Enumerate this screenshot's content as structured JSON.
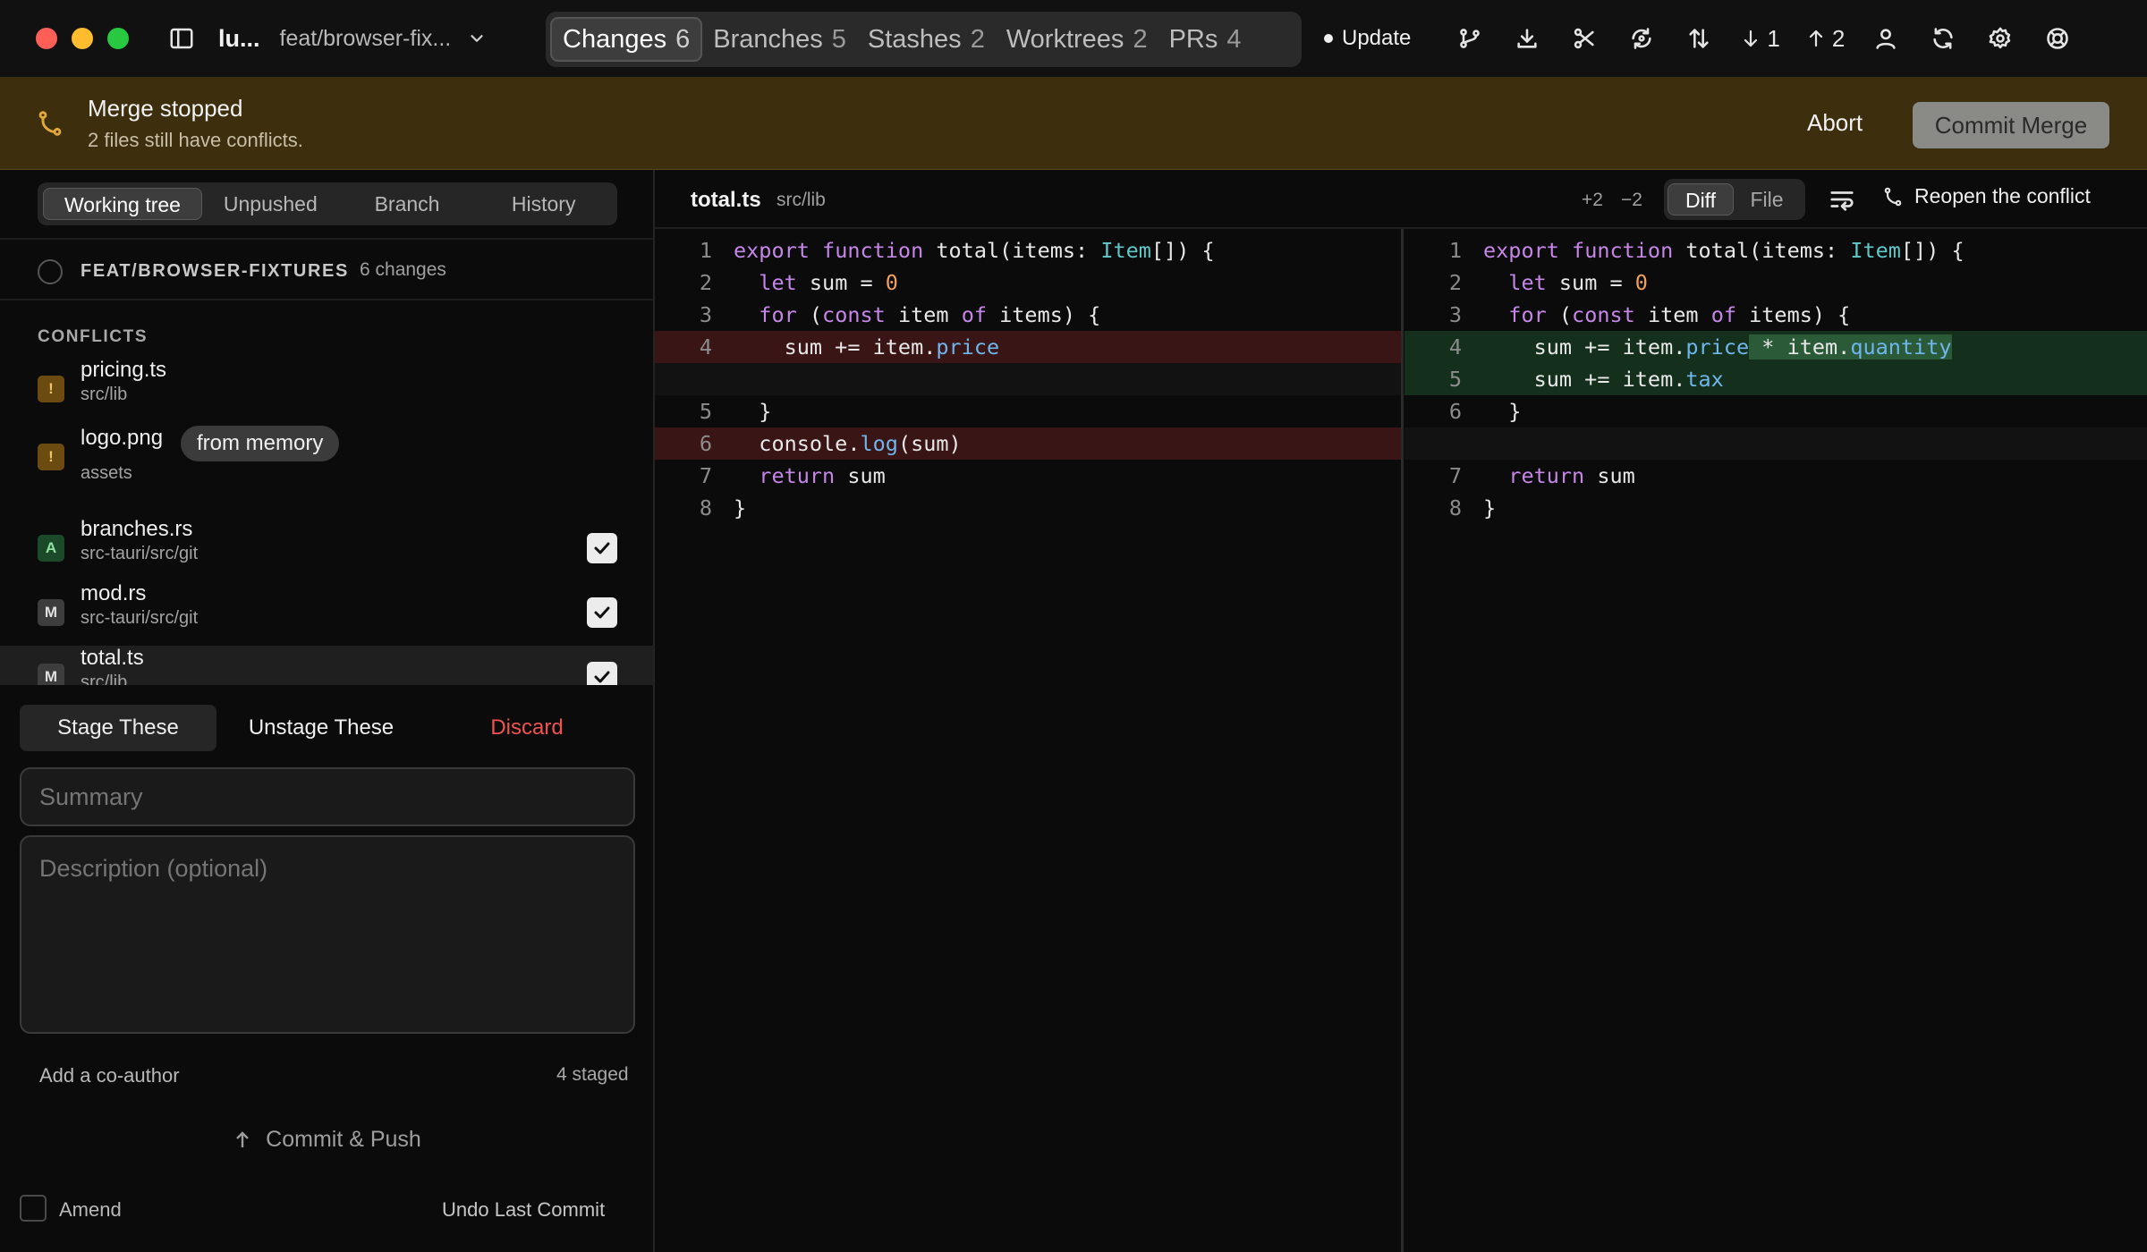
{
  "topbar": {
    "repo": "lu...",
    "branch": "feat/browser-fix...",
    "tabs": [
      {
        "label": "Changes",
        "count": "6"
      },
      {
        "label": "Branches",
        "count": "5"
      },
      {
        "label": "Stashes",
        "count": "2"
      },
      {
        "label": "Worktrees",
        "count": "2"
      },
      {
        "label": "PRs",
        "count": "4"
      }
    ],
    "update_label": "Update",
    "behind": "1",
    "ahead": "2"
  },
  "banner": {
    "title": "Merge stopped",
    "subtitle": "2 files still have conflicts.",
    "abort": "Abort",
    "commit_merge": "Commit Merge",
    "accent": "#e0a93a"
  },
  "sidebar": {
    "segments": [
      "Working tree",
      "Unpushed",
      "Branch",
      "History"
    ],
    "branch": "FEAT/BROWSER-FIXTURES",
    "branch_changes": "6 changes",
    "conflicts_label": "CONFLICTS",
    "files": [
      {
        "name": "pricing.ts",
        "path": "src/lib",
        "badge": "!"
      },
      {
        "name": "logo.png",
        "path": "assets",
        "badge": "!",
        "pill": "from memory"
      },
      {
        "name": "branches.rs",
        "path": "src-tauri/src/git",
        "badge": "A"
      },
      {
        "name": "mod.rs",
        "path": "src-tauri/src/git",
        "badge": "M"
      },
      {
        "name": "total.ts",
        "path": "src/lib",
        "badge": "M"
      }
    ],
    "stage": "Stage These",
    "unstage": "Unstage These",
    "discard": "Discard",
    "summary_placeholder": "Summary",
    "description_placeholder": "Description (optional)",
    "coauthor": "Add a co-author",
    "staged": "4 staged",
    "commit_push": "Commit & Push",
    "amend": "Amend",
    "undo": "Undo Last Commit"
  },
  "diff": {
    "file": "total.ts",
    "path": "src/lib",
    "additions": "+2",
    "deletions": "−2",
    "view_diff": "Diff",
    "view_file": "File",
    "reopen": "Reopen the conflict",
    "left_lines": [
      {
        "n": "1",
        "text": "export function total(items: Item[]) {"
      },
      {
        "n": "2",
        "text": "  let sum = 0"
      },
      {
        "n": "3",
        "text": "  for (const item of items) {"
      },
      {
        "n": "4",
        "text": "    sum += item.price"
      },
      {
        "n": "5",
        "text": "  }"
      },
      {
        "n": "6",
        "text": "  console.log(sum)"
      },
      {
        "n": "7",
        "text": "  return sum"
      },
      {
        "n": "8",
        "text": "}"
      }
    ],
    "right_lines": [
      {
        "n": "1",
        "text": "export function total(items: Item[]) {"
      },
      {
        "n": "2",
        "text": "  let sum = 0"
      },
      {
        "n": "3",
        "text": "  for (const item of items) {"
      },
      {
        "n": "4",
        "text": "    sum += item.price * item.quantity"
      },
      {
        "n": "5",
        "text": "    sum += item.tax"
      },
      {
        "n": "6",
        "text": "  }"
      },
      {
        "n": "7",
        "text": "  return sum"
      },
      {
        "n": "8",
        "text": "}"
      }
    ]
  }
}
